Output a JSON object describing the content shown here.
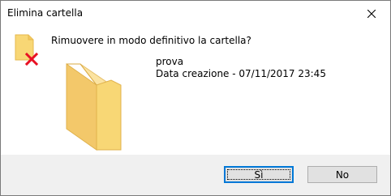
{
  "window": {
    "title": "Elimina cartella"
  },
  "dialog": {
    "question": "Rimuovere in modo definitivo la cartella?",
    "item_name": "prova",
    "item_date": "Data creazione - 07/11/2017 23:45"
  },
  "buttons": {
    "yes_label": "Sì",
    "no_label": "No"
  },
  "icons": {
    "close": "close-icon",
    "warning": "folder-delete-icon",
    "folder": "folder-icon"
  },
  "colors": {
    "folder_fill": "#f8d775",
    "folder_dark": "#e6b94e",
    "delete_x": "#e81123",
    "focus_border": "#0078d7"
  }
}
